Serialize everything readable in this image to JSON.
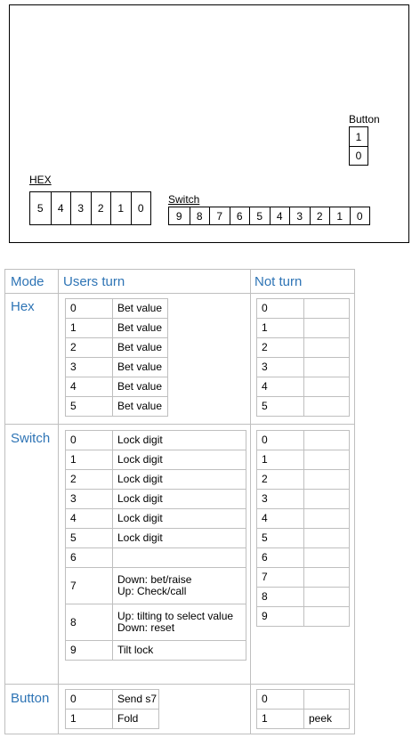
{
  "board": {
    "hex_label": "HEX",
    "hex_digits": [
      "5",
      "4",
      "3",
      "2",
      "1",
      "0"
    ],
    "switch_label": "Switch",
    "switch_digits": [
      "9",
      "8",
      "7",
      "6",
      "5",
      "4",
      "3",
      "2",
      "1",
      "0"
    ],
    "button_label": "Button",
    "button_digits": [
      "1",
      "0"
    ]
  },
  "table": {
    "headers": {
      "mode": "Mode",
      "users_turn": "Users turn",
      "not_turn": "Not turn"
    },
    "sections": {
      "hex": {
        "mode": "Hex",
        "users": [
          [
            "0",
            "Bet value"
          ],
          [
            "1",
            "Bet value"
          ],
          [
            "2",
            "Bet value"
          ],
          [
            "3",
            "Bet value"
          ],
          [
            "4",
            "Bet value"
          ],
          [
            "5",
            "Bet value"
          ]
        ],
        "not": [
          [
            "0",
            ""
          ],
          [
            "1",
            ""
          ],
          [
            "2",
            ""
          ],
          [
            "3",
            ""
          ],
          [
            "4",
            ""
          ],
          [
            "5",
            ""
          ]
        ]
      },
      "switch": {
        "mode": "Switch",
        "users": [
          [
            "0",
            "Lock digit"
          ],
          [
            "1",
            "Lock digit"
          ],
          [
            "2",
            "Lock digit"
          ],
          [
            "3",
            "Lock digit"
          ],
          [
            "4",
            "Lock digit"
          ],
          [
            "5",
            "Lock digit"
          ],
          [
            "6",
            ""
          ],
          [
            "7",
            "Down: bet/raise\nUp: Check/call"
          ],
          [
            "8",
            "Up: tilting to select value\nDown: reset"
          ],
          [
            "9",
            "Tilt lock"
          ]
        ],
        "not": [
          [
            "0",
            ""
          ],
          [
            "1",
            ""
          ],
          [
            "2",
            ""
          ],
          [
            "3",
            ""
          ],
          [
            "4",
            ""
          ],
          [
            "5",
            ""
          ],
          [
            "6",
            ""
          ],
          [
            "7",
            ""
          ],
          [
            "8",
            ""
          ],
          [
            "9",
            ""
          ]
        ]
      },
      "button": {
        "mode": "Button",
        "users": [
          [
            "0",
            "Send s7"
          ],
          [
            "1",
            "Fold"
          ]
        ],
        "not": [
          [
            "0",
            ""
          ],
          [
            "1",
            "peek"
          ]
        ]
      }
    }
  }
}
